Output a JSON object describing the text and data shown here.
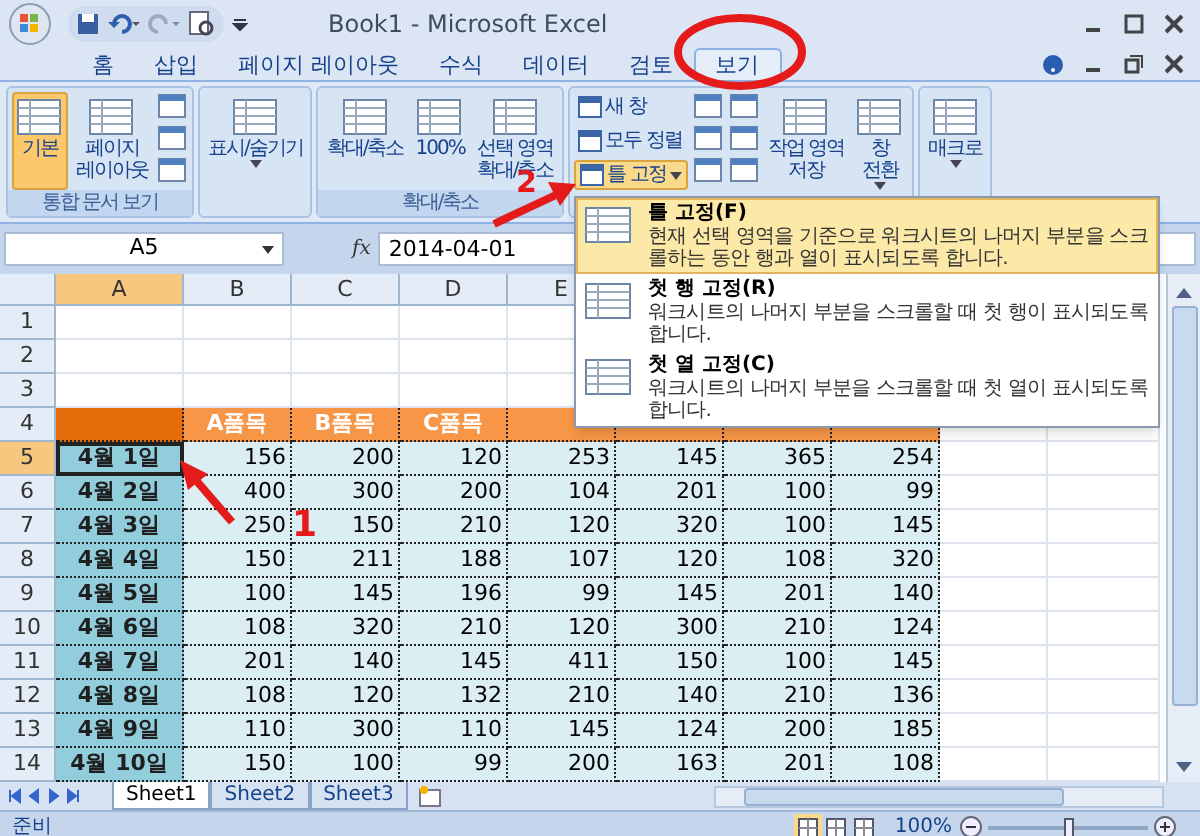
{
  "title_bar": {
    "title": "Book1 - Microsoft Excel"
  },
  "ribbon_tabs": [
    {
      "label": "홈",
      "selected": false
    },
    {
      "label": "삽입",
      "selected": false
    },
    {
      "label": "페이지 레이아웃",
      "selected": false
    },
    {
      "label": "수식",
      "selected": false
    },
    {
      "label": "데이터",
      "selected": false
    },
    {
      "label": "검토",
      "selected": false
    },
    {
      "label": "보기",
      "selected": true
    }
  ],
  "ribbon_groups": [
    {
      "label": "통합 문서 보기",
      "buttons": [
        {
          "kind": "large",
          "label": "기본",
          "selected": true,
          "dropdown": false
        },
        {
          "kind": "large",
          "label": "페이지\n레이아웃",
          "selected": false,
          "dropdown": false
        },
        {
          "kind": "icons"
        }
      ]
    },
    {
      "buttons": [
        {
          "kind": "large",
          "label": "표시/숨기기",
          "selected": false,
          "dropdown": true
        }
      ]
    },
    {
      "label": "확대/축소",
      "buttons": [
        {
          "kind": "large",
          "label": "확대/축소",
          "selected": false,
          "dropdown": false
        },
        {
          "kind": "large",
          "label": "100%",
          "selected": false,
          "dropdown": false
        },
        {
          "kind": "large",
          "label": "선택 영역\n확대/축소",
          "selected": false,
          "dropdown": false
        }
      ]
    },
    {
      "buttons": [
        {
          "kind": "small",
          "items": [
            {
              "label": "새 창",
              "selected": false,
              "dropdown": false
            },
            {
              "label": "모두 정렬",
              "selected": false,
              "dropdown": false
            },
            {
              "label": "틀 고정",
              "selected": true,
              "dropdown": true
            }
          ]
        },
        {
          "kind": "icons"
        },
        {
          "kind": "icons"
        },
        {
          "kind": "large",
          "label": "작업 영역\n저장",
          "selected": false,
          "dropdown": false
        },
        {
          "kind": "large",
          "label": "창\n전환",
          "selected": false,
          "dropdown": true
        }
      ]
    },
    {
      "buttons": [
        {
          "kind": "large",
          "label": "매크로",
          "selected": false,
          "dropdown": true
        }
      ]
    }
  ],
  "formula_bar": {
    "name_box": "A5",
    "function_label": "fx",
    "value": "2014-04-01"
  },
  "freeze_menu": [
    {
      "title": "틀 고정(F)",
      "description": "현재 선택 영역을 기준으로 워크시트의 나머지 부분을 스크롤하는 동안 행과 열이 표시되도록 합니다.",
      "selected": true
    },
    {
      "title": "첫 행 고정(R)",
      "description": "워크시트의 나머지 부분을 스크롤할 때 첫 행이 표시되도록 합니다.",
      "selected": false
    },
    {
      "title": "첫 열 고정(C)",
      "description": "워크시트의 나머지 부분을 스크롤할 때 첫 열이 표시되도록 합니다.",
      "selected": false
    }
  ],
  "columns": [
    {
      "label": "A",
      "selected": true
    },
    {
      "label": "B",
      "selected": false
    },
    {
      "label": "C",
      "selected": false
    },
    {
      "label": "D",
      "selected": false
    },
    {
      "label": "E",
      "selected": false
    }
  ],
  "rows": [
    {
      "number": "1",
      "selected": false,
      "kind": "empty",
      "cells": []
    },
    {
      "number": "2",
      "selected": false,
      "kind": "empty",
      "cells": []
    },
    {
      "number": "3",
      "selected": false,
      "kind": "empty",
      "cells": []
    },
    {
      "number": "4",
      "selected": false,
      "kind": "header",
      "cells": [
        "",
        "A품목",
        "B품목",
        "C품목"
      ]
    },
    {
      "number": "5",
      "selected": true,
      "kind": "data",
      "cells": [
        "4월 1일",
        "156",
        "200",
        "120",
        "253",
        "145",
        "365",
        "254"
      ]
    },
    {
      "number": "6",
      "selected": false,
      "kind": "data",
      "cells": [
        "4월 2일",
        "400",
        "300",
        "200",
        "104",
        "201",
        "100",
        "99"
      ]
    },
    {
      "number": "7",
      "selected": false,
      "kind": "data",
      "cells": [
        "4월 3일",
        "250",
        "150",
        "210",
        "120",
        "320",
        "100",
        "145"
      ]
    },
    {
      "number": "8",
      "selected": false,
      "kind": "data",
      "cells": [
        "4월 4일",
        "150",
        "211",
        "188",
        "107",
        "120",
        "108",
        "320"
      ]
    },
    {
      "number": "9",
      "selected": false,
      "kind": "data",
      "cells": [
        "4월 5일",
        "100",
        "145",
        "196",
        "99",
        "145",
        "201",
        "140"
      ]
    },
    {
      "number": "10",
      "selected": false,
      "kind": "data",
      "cells": [
        "4월 6일",
        "108",
        "320",
        "210",
        "120",
        "300",
        "210",
        "124"
      ]
    },
    {
      "number": "11",
      "selected": false,
      "kind": "data",
      "cells": [
        "4월 7일",
        "201",
        "140",
        "145",
        "411",
        "150",
        "100",
        "145"
      ]
    },
    {
      "number": "12",
      "selected": false,
      "kind": "data",
      "cells": [
        "4월 8일",
        "108",
        "120",
        "132",
        "210",
        "140",
        "210",
        "136"
      ]
    },
    {
      "number": "13",
      "selected": false,
      "kind": "data",
      "cells": [
        "4월 9일",
        "110",
        "300",
        "110",
        "145",
        "124",
        "200",
        "185"
      ]
    },
    {
      "number": "14",
      "selected": false,
      "kind": "data",
      "cells": [
        "4월 10일",
        "150",
        "100",
        "99",
        "200",
        "163",
        "201",
        "108"
      ]
    }
  ],
  "sheet_tabs": [
    {
      "label": "Sheet1",
      "selected": true
    },
    {
      "label": "Sheet2",
      "selected": false
    },
    {
      "label": "Sheet3",
      "selected": false
    }
  ],
  "status_bar": {
    "status": "준비",
    "views": [
      {
        "selected": true
      },
      {
        "selected": false
      },
      {
        "selected": false
      }
    ],
    "zoom": "100%",
    "zoom_slider": {
      "level": 0.5
    }
  },
  "annotations": [
    {
      "label": "1"
    },
    {
      "label": "2"
    }
  ]
}
